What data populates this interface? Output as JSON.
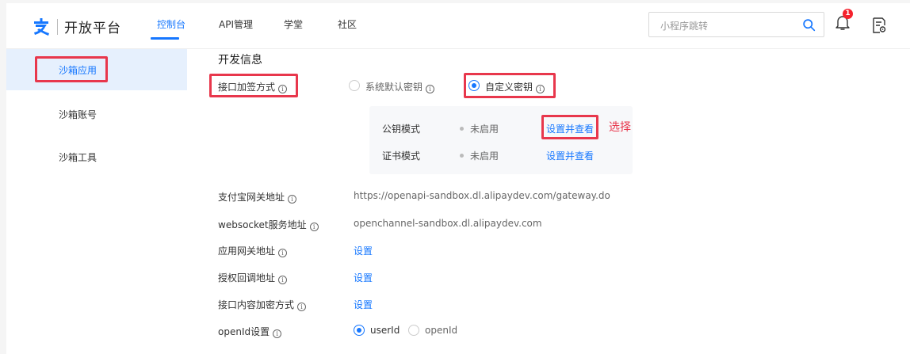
{
  "header": {
    "brand": "开放平台",
    "nav": [
      "控制台",
      "API管理",
      "学堂",
      "社区"
    ],
    "search_placeholder": "小程序跳转",
    "notification_count": "1"
  },
  "sidebar": {
    "items": [
      {
        "label": "沙箱应用"
      },
      {
        "label": "沙箱账号"
      },
      {
        "label": "沙箱工具"
      }
    ]
  },
  "dev_info": {
    "title": "开发信息",
    "sign_method": {
      "label": "接口加签方式",
      "options": [
        "系统默认密钥",
        "自定义密钥"
      ],
      "selected": "自定义密钥"
    },
    "key_modes": [
      {
        "name": "公钥模式",
        "status": "未启用",
        "action": "设置并查看"
      },
      {
        "name": "证书模式",
        "status": "未启用",
        "action": "设置并查看"
      }
    ],
    "annotation": "选择",
    "fields": [
      {
        "label": "支付宝网关地址",
        "value": "https://openapi-sandbox.dl.alipaydev.com/gateway.do"
      },
      {
        "label": "websocket服务地址",
        "value": "openchannel-sandbox.dl.alipaydev.com"
      },
      {
        "label": "应用网关地址",
        "value": "设置"
      },
      {
        "label": "授权回调地址",
        "value": "设置"
      },
      {
        "label": "接口内容加密方式",
        "value": "设置"
      }
    ],
    "openid": {
      "label": "openId设置",
      "options": [
        "userId",
        "openId"
      ],
      "selected": "userId"
    }
  },
  "colors": {
    "accent": "#1677ff",
    "highlight_red": "#e8374c"
  }
}
